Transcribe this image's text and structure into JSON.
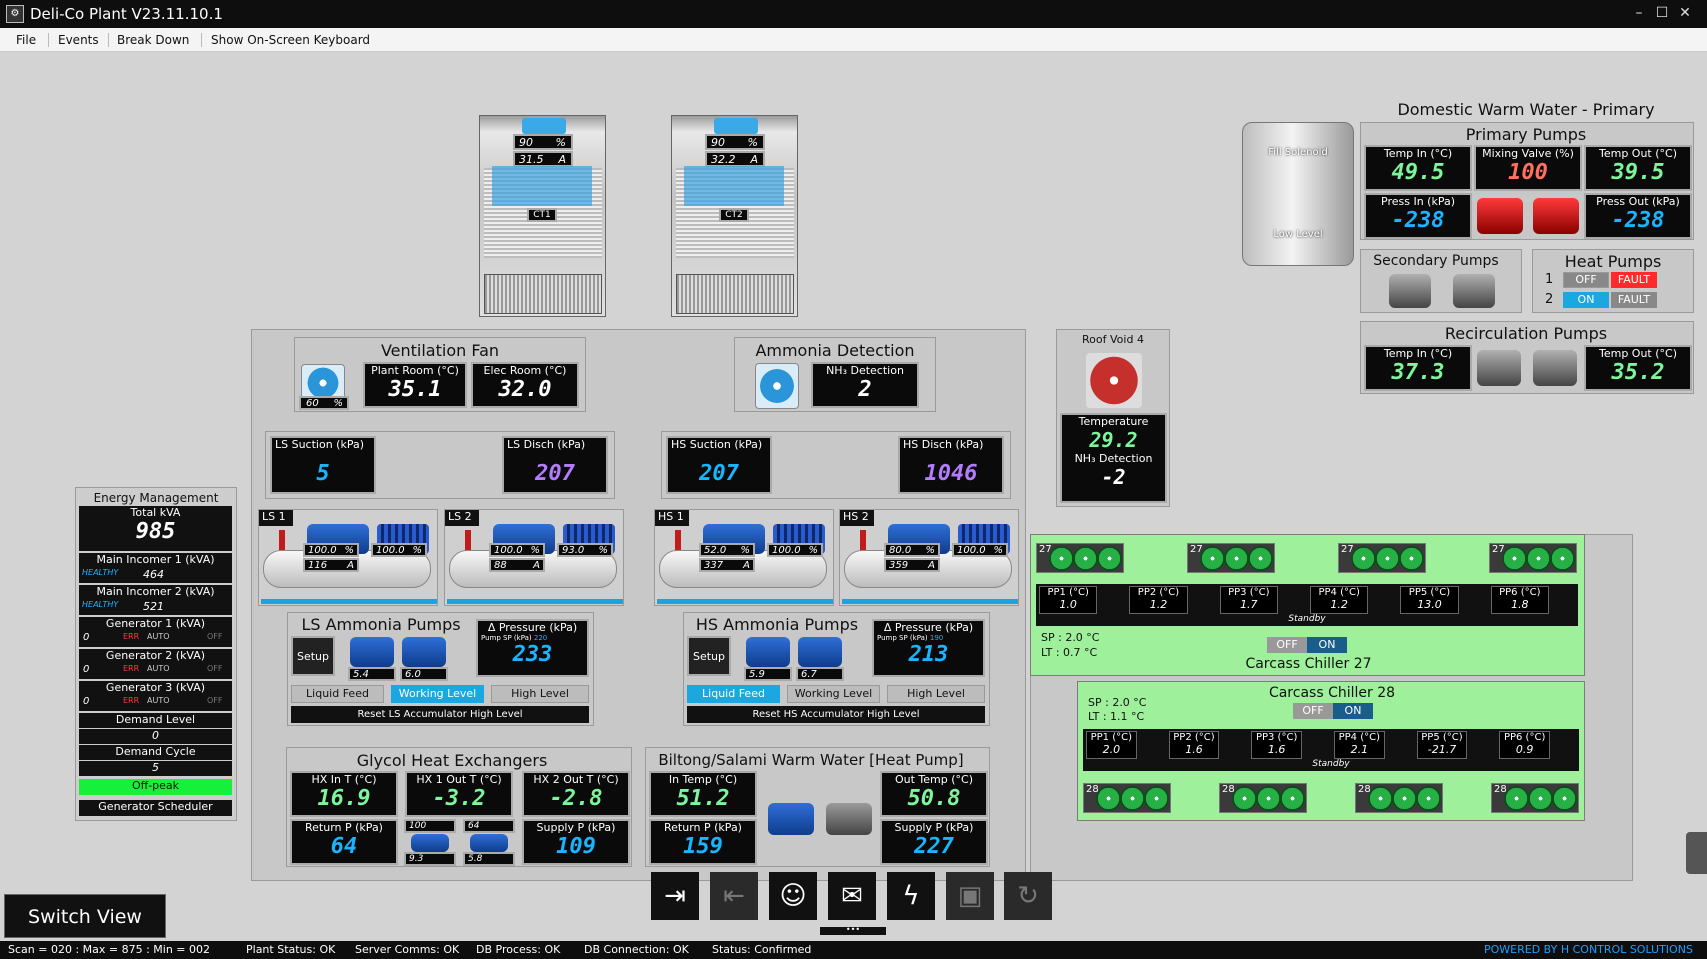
{
  "window": {
    "title": "Deli-Co Plant V23.11.10.1"
  },
  "menu": {
    "file": "File",
    "events": "Events",
    "breakdown": "Break Down",
    "keyboard": "Show On-Screen Keyboard"
  },
  "ct1": {
    "percent": "90",
    "pct_unit": "%",
    "amps": "31.5",
    "amp_unit": "A",
    "label": "CT1"
  },
  "ct2": {
    "percent": "90",
    "pct_unit": "%",
    "amps": "32.2",
    "amp_unit": "A",
    "label": "CT2"
  },
  "vent": {
    "title": "Ventilation Fan",
    "fan_pct": "60",
    "pct_unit": "%",
    "plant_label": "Plant Room (°C)",
    "plant_val": "35.1",
    "elec_label": "Elec Room (°C)",
    "elec_val": "32.0"
  },
  "ammonia": {
    "title": "Ammonia Detection",
    "nh3_label": "NH₃ Detection",
    "nh3_val": "2"
  },
  "ls": {
    "suction_label": "LS Suction (kPa)",
    "suction_val": "5",
    "disch_label": "LS Disch (kPa)",
    "disch_val": "207"
  },
  "hs": {
    "suction_label": "HS Suction (kPa)",
    "suction_val": "207",
    "disch_label": "HS Disch (kPa)",
    "disch_val": "1046"
  },
  "compressors": [
    {
      "name": "LS 1",
      "pct1": "100.0",
      "pct2": "100.0",
      "amps": "116"
    },
    {
      "name": "LS 2",
      "pct1": "100.0",
      "pct2": "93.0",
      "amps": "88"
    },
    {
      "name": "HS 1",
      "pct1": "52.0",
      "pct2": "100.0",
      "amps": "337"
    },
    {
      "name": "HS 2",
      "pct1": "80.0",
      "pct2": "100.0",
      "amps": "359"
    }
  ],
  "units": {
    "pct": "%",
    "amp": "A"
  },
  "ls_pumps": {
    "title": "LS Ammonia Pumps",
    "setup": "Setup",
    "p1": "1",
    "p2": "2",
    "p1_amps": "5.4",
    "p2_amps": "6.0",
    "dp_label": "Δ Pressure (kPa)",
    "sp_label": "Pump SP (kPa)",
    "sp_val": "220",
    "dp_val": "233",
    "liquid": "Liquid Feed",
    "working": "Working Level",
    "high": "High Level",
    "reset": "Reset LS Accumulator High Level"
  },
  "hs_pumps": {
    "title": "HS Ammonia Pumps",
    "setup": "Setup",
    "p1": "1",
    "p2": "2",
    "p1_amps": "5.9",
    "p2_amps": "6.7",
    "dp_label": "Δ Pressure (kPa)",
    "sp_label": "Pump SP (kPa)",
    "sp_val": "190",
    "dp_val": "213",
    "liquid": "Liquid Feed",
    "working": "Working Level",
    "high": "High Level",
    "reset": "Reset HS Accumulator High Level"
  },
  "glycol": {
    "title": "Glycol Heat Exchangers",
    "hx_in_label": "HX In T (°C)",
    "hx_in": "16.9",
    "hx1_label": "HX 1 Out T (°C)",
    "hx1": "-3.2",
    "hx2_label": "HX 2 Out T (°C)",
    "hx2": "-2.8",
    "ret_label": "Return P (kPa)",
    "ret": "64",
    "sup_label": "Supply P (kPa)",
    "sup": "109",
    "p1_pct": "100",
    "p2_pct": "64",
    "p1_amps": "9.3",
    "p2_amps": "5.8",
    "p1": "1",
    "p2": "2"
  },
  "biltong": {
    "title": "Biltong/Salami Warm Water [Heat Pump]",
    "in_label": "In Temp (°C)",
    "in": "51.2",
    "out_label": "Out Temp (°C)",
    "out": "50.8",
    "ret_label": "Return P (kPa)",
    "ret": "159",
    "sup_label": "Supply P (kPa)",
    "sup": "227",
    "p1": "1",
    "p2": "2"
  },
  "energy": {
    "title": "Energy Management",
    "total_label": "Total kVA",
    "total": "985",
    "inc1_label": "Main Incomer 1 (kVA)",
    "healthy": "HEALTHY",
    "inc1": "464",
    "inc2_label": "Main Incomer 2 (kVA)",
    "inc2": "521",
    "gen1_label": "Generator 1 (kVA)",
    "gen2_label": "Generator 2 (kVA)",
    "gen3_label": "Generator 3 (kVA)",
    "gen_val": "0",
    "auto": "AUTO",
    "off": "OFF",
    "err": "ERR",
    "demand_label": "Demand Level",
    "demand": "0",
    "cycle_label": "Demand Cycle",
    "cycle": "5",
    "peak": "Off-peak",
    "scheduler": "Generator Scheduler"
  },
  "roof": {
    "title": "Roof Void 4",
    "fan_no": "4",
    "temp_label": "Temperature",
    "temp": "29.2",
    "nh3_label": "NH₃ Detection",
    "nh3": "-2"
  },
  "dww": {
    "title": "Domestic Warm Water - Primary",
    "fill": "Fill Solenoid",
    "low": "Low Level",
    "primary": {
      "title": "Primary Pumps",
      "tin_label": "Temp In (°C)",
      "tin": "49.5",
      "mix_label": "Mixing Valve (%)",
      "mix": "100",
      "tout_label": "Temp Out (°C)",
      "tout": "39.5",
      "pin_label": "Press In (kPa)",
      "pin": "-238",
      "pout_label": "Press Out (kPa)",
      "pout": "-238",
      "p1": "1",
      "p2": "2"
    },
    "secondary": {
      "title": "Secondary Pumps",
      "p1": "1",
      "p2": "2"
    },
    "heat": {
      "title": "Heat Pumps",
      "r1": "1",
      "r2": "2",
      "off": "OFF",
      "on": "ON",
      "fault": "FAULT"
    },
    "recirc": {
      "title": "Recirculation Pumps",
      "tin_label": "Temp In (°C)",
      "tin": "37.3",
      "tout_label": "Temp Out (°C)",
      "tout": "35.2",
      "p1": "1",
      "p2": "2"
    }
  },
  "chiller27": {
    "title": "Carcass Chiller 27",
    "sp": "SP : 2.0 °C",
    "lt": "LT : 0.7 °C",
    "off": "OFF",
    "on": "ON",
    "standby": "Standby",
    "no": "27",
    "pp": [
      {
        "label": "PP1 (°C)",
        "val": "1.0"
      },
      {
        "label": "PP2 (°C)",
        "val": "1.2"
      },
      {
        "label": "PP3 (°C)",
        "val": "1.7"
      },
      {
        "label": "PP4 (°C)",
        "val": "1.2"
      },
      {
        "label": "PP5 (°C)",
        "val": "13.0"
      },
      {
        "label": "PP6 (°C)",
        "val": "1.8"
      }
    ]
  },
  "chiller28": {
    "title": "Carcass Chiller 28",
    "sp": "SP : 2.0 °C",
    "lt": "LT : 1.1 °C",
    "off": "OFF",
    "on": "ON",
    "standby": "Standby",
    "no": "28",
    "pp": [
      {
        "label": "PP1 (°C)",
        "val": "2.0"
      },
      {
        "label": "PP2 (°C)",
        "val": "1.6"
      },
      {
        "label": "PP3 (°C)",
        "val": "1.6"
      },
      {
        "label": "PP4 (°C)",
        "val": "2.1"
      },
      {
        "label": "PP5 (°C)",
        "val": "-21.7"
      },
      {
        "label": "PP6 (°C)",
        "val": "0.9"
      }
    ]
  },
  "switch_view": "Switch View",
  "status": {
    "scan": "Scan = 020 : Max = 875 : Min = 002",
    "plant": "Plant Status: OK",
    "server": "Server Comms: OK",
    "db": "DB Process:  OK",
    "dbconn": "DB Connection:  OK",
    "state": "Status:  Confirmed",
    "powered": "POWERED BY H CONTROL SOLUTIONS"
  },
  "icons": [
    "login-icon",
    "logout-icon",
    "user-settings-icon",
    "mail-icon",
    "power-icon",
    "save-icon",
    "refresh-icon"
  ]
}
